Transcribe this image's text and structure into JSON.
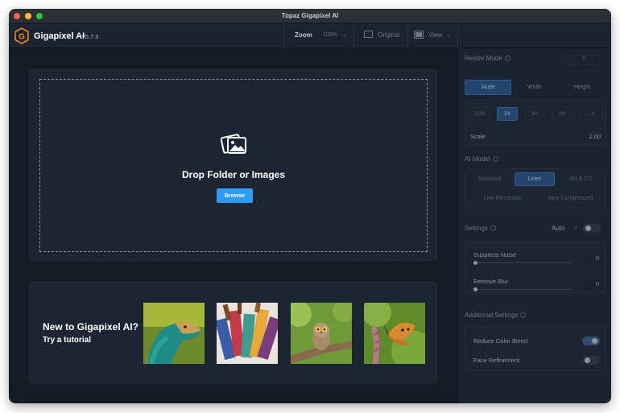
{
  "window": {
    "title": "Topaz Gigapixel AI"
  },
  "app": {
    "name": "Gigapixel AI",
    "version": "v5.7.3"
  },
  "toolbar": {
    "zoom_label": "Zoom",
    "zoom_value": "100%",
    "original_label": "Original",
    "view_label": "View"
  },
  "drop": {
    "title": "Drop Folder or Images",
    "browse_label": "Browse"
  },
  "tutorial": {
    "title": "New to Gigapixel AI?",
    "subtitle": "Try a tutorial",
    "thumbnails": [
      "lizard-photo",
      "paintbrushes-photo",
      "owl-photo",
      "butterfly-photo"
    ]
  },
  "sidebar": {
    "resize_mode": {
      "label": "Resize Mode",
      "right_tag": "Tı",
      "tabs": [
        "Scale",
        "Width",
        "Height"
      ],
      "active_tab": "Scale",
      "scale_options": [
        "0.5x",
        "2x",
        "4x",
        "6x",
        "...s"
      ],
      "active_scale": "2x",
      "scale_label": "Scale",
      "scale_value": "2.00"
    },
    "ai_model": {
      "label": "AI Model",
      "models_row1": [
        "Standard",
        "Lines",
        "Art & CG"
      ],
      "models_row2": [
        "Low Resolution",
        "Very Compressed"
      ],
      "active_model": "Lines"
    },
    "settings": {
      "label": "Settings",
      "auto_label": "Auto",
      "suppress_noise": {
        "label": "Suppress Noise",
        "value": "0"
      },
      "remove_blur": {
        "label": "Remove Blur",
        "value": "0"
      }
    },
    "additional": {
      "label": "Additional Settings",
      "reduce_color_bleed": {
        "label": "Reduce Color Bleed",
        "on": true
      },
      "face_refinement": {
        "label": "Face Refinement",
        "on": false
      }
    }
  },
  "colors": {
    "accent": "#2f9bf5",
    "active_segment": "#24456e",
    "background": "#161c26"
  }
}
